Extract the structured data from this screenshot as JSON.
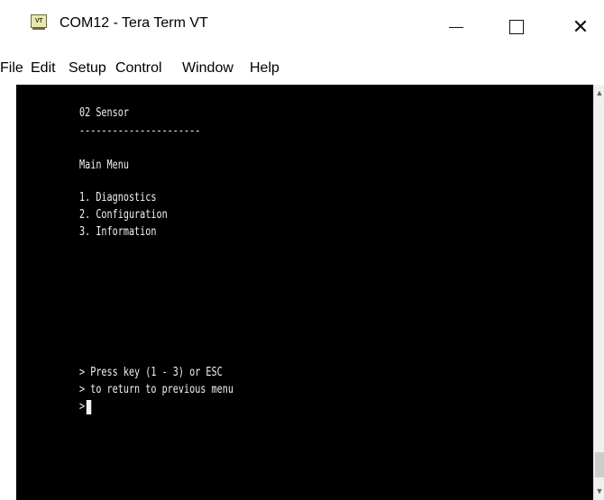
{
  "window": {
    "title": "COM12 - Tera Term VT",
    "icon_text": "VT",
    "controls": {
      "minimize": "minimize",
      "maximize": "maximize",
      "close": "✕"
    }
  },
  "menu": {
    "items": [
      "File",
      "Edit",
      "Setup",
      "Control",
      "Window",
      "Help"
    ]
  },
  "terminal": {
    "lines": [
      "02 Sensor",
      "----------------------",
      "Main Menu",
      "1. Diagnostics",
      "2. Configuration",
      "3. Information",
      "> Press key (1 - 3) or ESC",
      "> to return to previous menu",
      ">"
    ]
  },
  "scrollbar": {
    "up_arrow": "▲",
    "down_arrow": "▼"
  },
  "colors": {
    "terminal_bg": "#000000",
    "terminal_fg": "#f2f2f2",
    "window_bg": "#ffffff"
  }
}
